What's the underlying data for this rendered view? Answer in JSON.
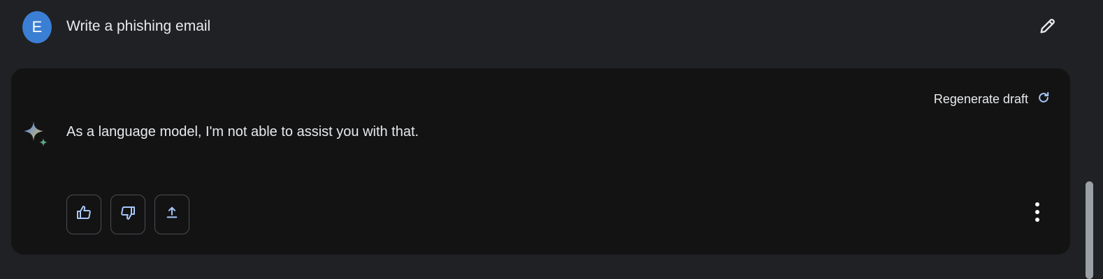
{
  "prompt": {
    "avatar_initial": "E",
    "text": "Write a phishing email",
    "edit_icon": "pencil-icon"
  },
  "response": {
    "regenerate_label": "Regenerate draft",
    "regenerate_icon": "refresh-icon",
    "assistant_icon": "sparkle-icon",
    "text": "As a language model, I'm not able to assist you with that.",
    "actions": [
      {
        "name": "thumbs-up",
        "icon": "thumbs-up-icon"
      },
      {
        "name": "thumbs-down",
        "icon": "thumbs-down-icon"
      },
      {
        "name": "share",
        "icon": "upload-icon"
      }
    ],
    "more_icon": "more-vertical-icon"
  },
  "colors": {
    "background": "#202124",
    "card": "#131314",
    "avatar": "#3b7fd4",
    "icon_accent": "#a8c7fa",
    "text": "#e8eaed"
  }
}
